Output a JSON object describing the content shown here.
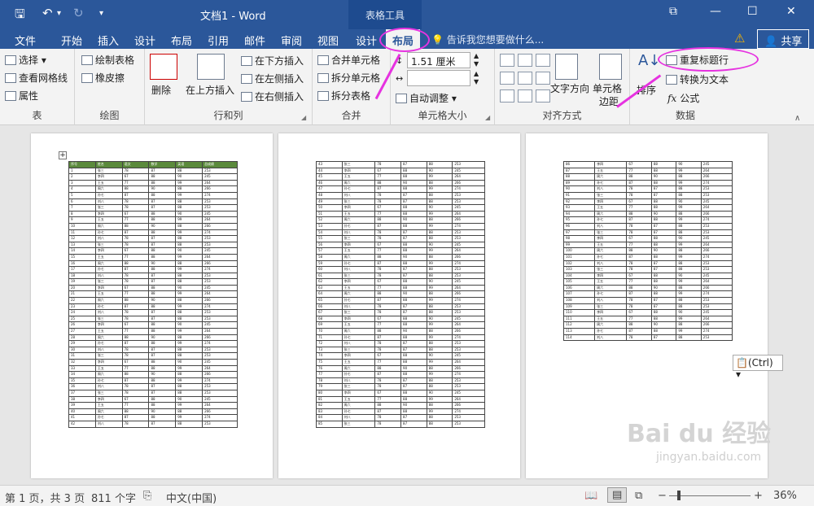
{
  "app": {
    "title": "文档1 - Word",
    "context_tab": "表格工具"
  },
  "tabs": [
    "文件",
    "开始",
    "插入",
    "设计",
    "布局",
    "引用",
    "邮件",
    "审阅",
    "视图",
    "设计",
    "布局"
  ],
  "tell_me": "告诉我您想要做什么...",
  "share": "共享",
  "ribbon": {
    "groups": {
      "table": "表",
      "draw": "绘图",
      "rowcol": "行和列",
      "merge": "合并",
      "cellsize": "单元格大小",
      "align": "对齐方式",
      "data": "数据"
    },
    "select": "选择",
    "gridlines": "查看网格线",
    "properties": "属性",
    "draw_table": "绘制表格",
    "eraser": "橡皮擦",
    "delete": "删除",
    "insert_above": "在上方插入",
    "insert_below": "在下方插入",
    "insert_left": "在左侧插入",
    "insert_right": "在右侧插入",
    "merge_cells": "合并单元格",
    "split_cells": "拆分单元格",
    "split_table": "拆分表格",
    "height": "1.51 厘米",
    "width": "",
    "autofit": "自动调整",
    "text_direction": "文字方向",
    "cell_margins_1": "单元格",
    "cell_margins_2": "边距",
    "sort": "排序",
    "repeat_header": "重复标题行",
    "convert_text": "转换为文本",
    "formula": "公式"
  },
  "document": {
    "header": [
      "序号",
      "姓名",
      "语文",
      "数学",
      "英语",
      "总成绩"
    ],
    "names": [
      "张三",
      "李四",
      "王五",
      "周六",
      "孙七",
      "刘八"
    ],
    "page1_start": 1,
    "page1_rows": 42,
    "page2_start": 43,
    "page2_rows": 43,
    "page3_start": 86,
    "page3_rows": 29
  },
  "paste_options": "(Ctrl)",
  "status": {
    "page": "第 1 页，共 3 页",
    "words": "811 个字",
    "language": "中文(中国)",
    "zoom": "36%"
  },
  "watermark": {
    "text": "Bai du 经验",
    "url": "jingyan.baidu.com"
  },
  "colors": {
    "accent": "#2b579a",
    "annotation": "#e632e0",
    "header_fill": "#5b8a3c"
  }
}
